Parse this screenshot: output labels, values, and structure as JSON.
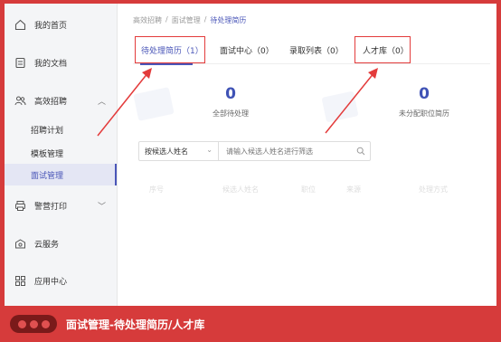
{
  "sidebar": {
    "items": [
      {
        "label": "我的首页",
        "icon": "home-icon"
      },
      {
        "label": "我的文档",
        "icon": "document-icon"
      },
      {
        "label": "高效招聘",
        "icon": "people-icon",
        "expanded": true
      },
      {
        "label": "警营打印",
        "icon": "printer-icon"
      },
      {
        "label": "云服务",
        "icon": "cloud-icon"
      },
      {
        "label": "应用中心",
        "icon": "grid-icon"
      }
    ],
    "subitems": [
      "招聘计划",
      "模板管理",
      "面试管理"
    ],
    "active_subitem": "面试管理"
  },
  "breadcrumb": {
    "items": [
      "高效招聘",
      "面试管理",
      "待处理简历"
    ],
    "separator": "/"
  },
  "tabs": [
    {
      "label": "待处理简历（1）",
      "active": true
    },
    {
      "label": "面试中心（0）",
      "active": false
    },
    {
      "label": "录取列表（0）",
      "active": false
    },
    {
      "label": "人才库（0）",
      "active": false
    }
  ],
  "stats": [
    {
      "value": "0",
      "label": "全部待处理"
    },
    {
      "value": "0",
      "label": "未分配职位简历"
    }
  ],
  "filter": {
    "select_value": "按候选人姓名",
    "input_placeholder": "请输入候选人姓名进行筛选"
  },
  "table": {
    "columns": [
      "序号",
      "候选人姓名",
      "职位",
      "来源",
      "处理方式"
    ]
  },
  "caption": "面试管理-待处理简历/人才库",
  "colors": {
    "accent": "#4a56b8",
    "highlight": "#e33b3b",
    "background": "#d63b3b"
  }
}
